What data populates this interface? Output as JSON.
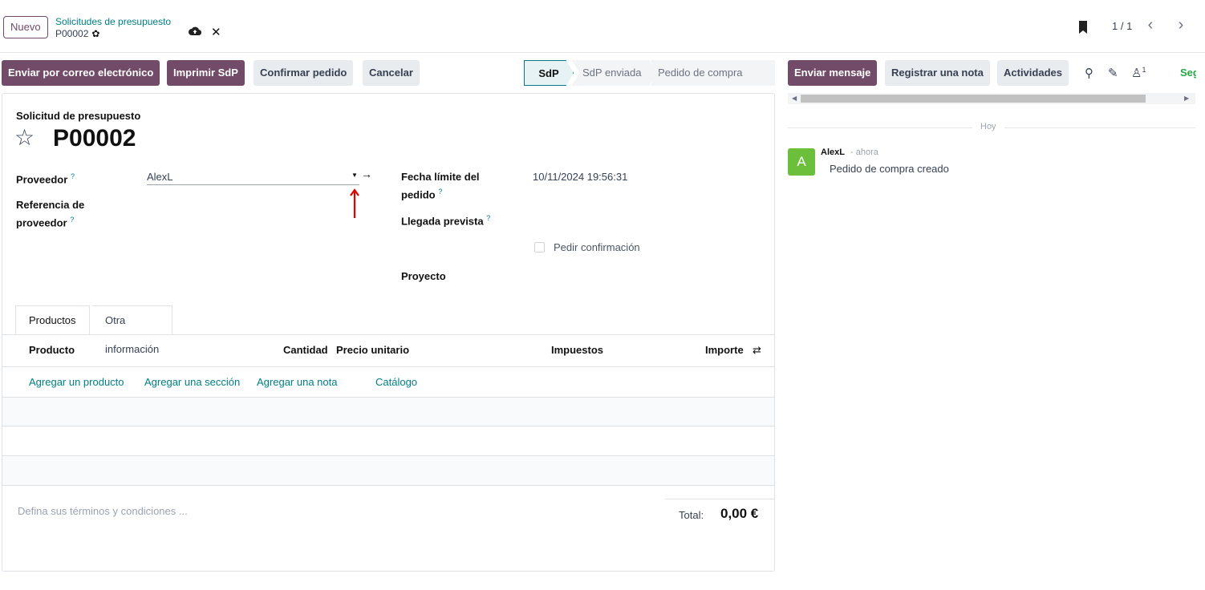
{
  "control_panel": {
    "new_button": "Nuevo",
    "breadcrumb": "Solicitudes de presupuesto",
    "record_name": "P00002",
    "pager_value": "1 / 1"
  },
  "actions": {
    "email": "Enviar por correo electrónico",
    "print": "Imprimir SdP",
    "confirm": "Confirmar pedido",
    "cancel": "Cancelar"
  },
  "statusbar": {
    "stages": [
      "SdP",
      "SdP enviada",
      "Pedido de compra"
    ],
    "active_stage": "SdP"
  },
  "form": {
    "header_label": "Solicitud de presupuesto",
    "name": "P00002",
    "vendor_label": "Proveedor",
    "vendor_value": "AlexL",
    "vendor_ref_label_1": "Referencia de",
    "vendor_ref_label_2": "proveedor",
    "deadline_label_1": "Fecha límite del",
    "deadline_label_2": "pedido",
    "deadline_value": "10/11/2024 19:56:31",
    "expected_label": "Llegada prevista",
    "ask_confirm_label": "Pedir confirmación",
    "ask_confirm_checked": false,
    "project_label": "Proyecto",
    "help_mark": "?"
  },
  "tabs": {
    "products": "Productos",
    "other_info": "Otra información"
  },
  "lines_table": {
    "col_product": "Producto",
    "col_qty": "Cantidad",
    "col_price": "Precio unitario",
    "col_taxes": "Impuestos",
    "col_amount": "Importe",
    "add_product": "Agregar un producto",
    "add_section": "Agregar una sección",
    "add_note": "Agregar una nota",
    "catalog": "Catálogo"
  },
  "footer": {
    "terms_placeholder": "Defina sus términos y condiciones ...",
    "total_label": "Total:",
    "total_value": "0,00 €"
  },
  "chatter": {
    "send_message": "Enviar mensaje",
    "log_note": "Registrar una nota",
    "activities": "Actividades",
    "followers_count": "1",
    "follow": "Seguir",
    "day_label": "Hoy",
    "avatar_letter": "A",
    "author": "AlexL",
    "when": "- ahora",
    "message": "Pedido de compra creado"
  },
  "colors": {
    "primary": "#714b67",
    "link": "#017e84",
    "avatar": "#6bbf3a",
    "annotation_arrow": "#e00000"
  }
}
